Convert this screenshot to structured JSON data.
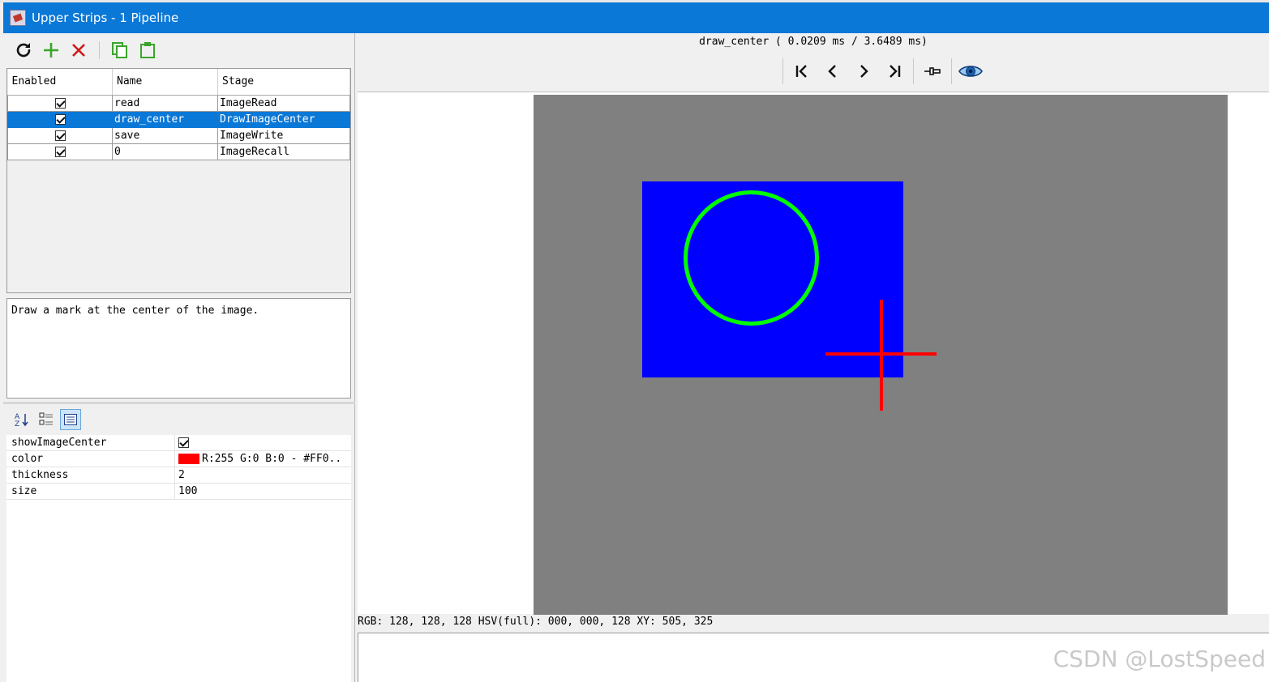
{
  "window": {
    "title": "Upper Strips - 1 Pipeline"
  },
  "toolbar": {
    "buttons": [
      {
        "name": "refresh",
        "icon": "refresh-icon",
        "color": "#111111"
      },
      {
        "name": "add",
        "icon": "plus-icon",
        "color": "#3aa52b"
      },
      {
        "name": "remove",
        "icon": "close-icon",
        "color": "#d01818"
      },
      {
        "name": "copy",
        "icon": "copy-icon",
        "color": "#3aa52b"
      },
      {
        "name": "paste",
        "icon": "paste-icon",
        "color": "#3aa52b"
      }
    ]
  },
  "pipeline": {
    "columns": [
      "Enabled",
      "Name",
      "Stage"
    ],
    "rows": [
      {
        "enabled": true,
        "name": "read",
        "stage": "ImageRead",
        "selected": false
      },
      {
        "enabled": true,
        "name": "draw_center",
        "stage": "DrawImageCenter",
        "selected": true
      },
      {
        "enabled": true,
        "name": "save",
        "stage": "ImageWrite",
        "selected": false
      },
      {
        "enabled": true,
        "name": "0",
        "stage": "ImageRecall",
        "selected": false
      }
    ]
  },
  "description": "Draw a mark at the center of the image.",
  "property_toolbar": [
    "sort-alphabetical-icon",
    "categorized-icon",
    "description-icon"
  ],
  "properties": [
    {
      "key": "showImageCenter",
      "type": "checkbox",
      "value": true
    },
    {
      "key": "color",
      "type": "color",
      "value": "R:255 G:0 B:0 - #FF0..",
      "swatch": "#ff0000"
    },
    {
      "key": "thickness",
      "type": "text",
      "value": "2"
    },
    {
      "key": "size",
      "type": "text",
      "value": "100"
    }
  ],
  "viewer": {
    "stage_title": "draw_center ( 0.0209 ms / 3.6489 ms)",
    "nav_icons": [
      "first-icon",
      "previous-icon",
      "next-icon",
      "last-icon",
      "pin-icon",
      "eye-icon"
    ],
    "canvas_color": "#808080",
    "image_color": "#0000ff",
    "circle_color": "#00ff00",
    "cross_color": "#ff0000",
    "status": "RGB: 128, 128, 128 HSV(full): 000, 000, 128 XY: 505, 325"
  },
  "watermark": "CSDN @LostSpeed"
}
